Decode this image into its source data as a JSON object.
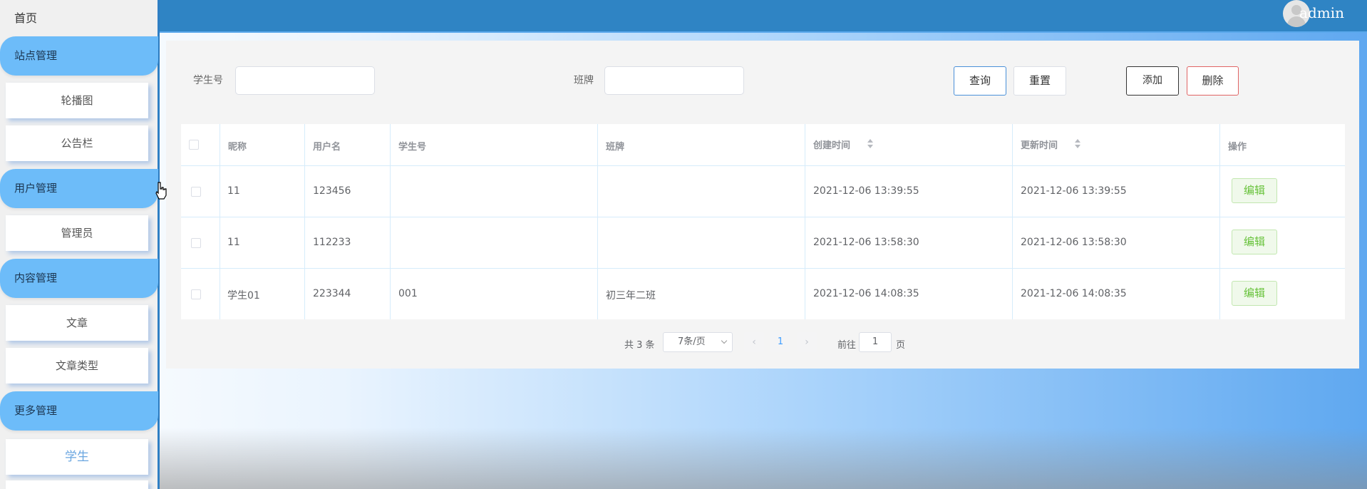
{
  "sidebar": {
    "home": "首页",
    "groups": [
      {
        "label": "站点管理",
        "items": [
          "轮播图",
          "公告栏"
        ]
      },
      {
        "label": "用户管理",
        "items": [
          "管理员"
        ]
      },
      {
        "label": "内容管理",
        "items": [
          "文章",
          "文章类型"
        ]
      },
      {
        "label": "更多管理",
        "items": [
          "学生"
        ]
      }
    ],
    "active_item": "学生"
  },
  "header": {
    "username": "admin",
    "avatar_icon": "user-avatar-icon"
  },
  "search": {
    "student_no_label": "学生号",
    "student_no_value": "",
    "class_label": "班牌",
    "class_value": "",
    "query_label": "查询",
    "reset_label": "重置",
    "add_label": "添加",
    "delete_label": "删除"
  },
  "table": {
    "columns": [
      "昵称",
      "用户名",
      "学生号",
      "班牌",
      "创建时间",
      "更新时间",
      "操作"
    ],
    "rows": [
      {
        "nickname": "11",
        "username": "123456",
        "student_no": "",
        "class": "",
        "created": "2021-12-06 13:39:55",
        "updated": "2021-12-06 13:39:55",
        "action": "编辑"
      },
      {
        "nickname": "11",
        "username": "112233",
        "student_no": "",
        "class": "",
        "created": "2021-12-06 13:58:30",
        "updated": "2021-12-06 13:58:30",
        "action": "编辑"
      },
      {
        "nickname": "学生01",
        "username": "223344",
        "student_no": "001",
        "class": "初三年二班",
        "created": "2021-12-06 14:08:35",
        "updated": "2021-12-06 14:08:35",
        "action": "编辑"
      }
    ]
  },
  "pagination": {
    "total_text": "共 3 条",
    "page_size": "7条/页",
    "current_page": "1",
    "goto_label": "前往",
    "goto_value": "1",
    "page_suffix": "页"
  },
  "colors": {
    "header": "#2f84c4",
    "sidebar_group": "#6dbcf9",
    "edit_green": "#67c23a",
    "active_item": "#6aa6e0"
  }
}
